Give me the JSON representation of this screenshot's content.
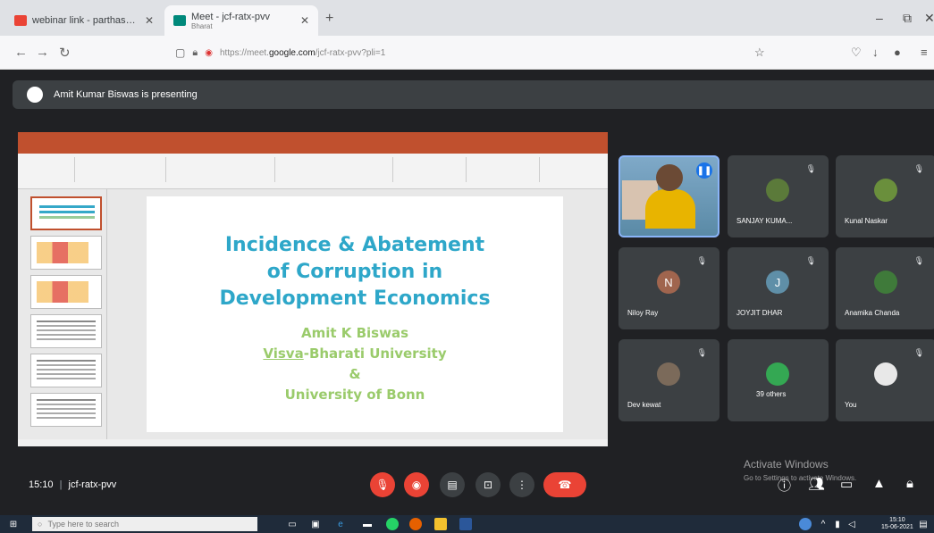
{
  "browser": {
    "tabs": [
      {
        "title": "webinar link - parthasarathon"
      },
      {
        "title": "Meet - jcf-ratx-pvv",
        "subtitle": "Bharat"
      }
    ],
    "url_prefix": "https://meet.",
    "url_domain": "google.com",
    "url_suffix": "/jcf-ratx-pvv?pli=1"
  },
  "meet": {
    "presenting_text": "Amit Kumar Biswas is presenting",
    "meeting_time": "15:10",
    "meeting_code": "jcf-ratx-pvv",
    "activate_title": "Activate Windows",
    "activate_sub": "Go to Settings to activate Windows."
  },
  "slide": {
    "title_lines": [
      "Incidence & Abatement",
      "of Corruption in",
      "Development Economics"
    ],
    "author": "Amit K Biswas",
    "affil1_underlined": "Visva",
    "affil1_rest": "-Bharati University",
    "amp": "&",
    "affil2": "University of Bonn"
  },
  "participants": [
    {
      "name": "SANJAY KUMA..."
    },
    {
      "name": "Kunal Naskar"
    },
    {
      "name": "Niloy Ray",
      "initial": "N",
      "color": "#a0654e"
    },
    {
      "name": "JOYJIT DHAR",
      "initial": "J",
      "color": "#5f8fa8"
    },
    {
      "name": "Anamika Chanda"
    },
    {
      "name": "Dev kewat"
    },
    {
      "name": "39 others"
    },
    {
      "name": "You"
    }
  ],
  "taskbar": {
    "search_placeholder": "Type here to search",
    "time": "15:10",
    "date": "15-06-2021"
  }
}
